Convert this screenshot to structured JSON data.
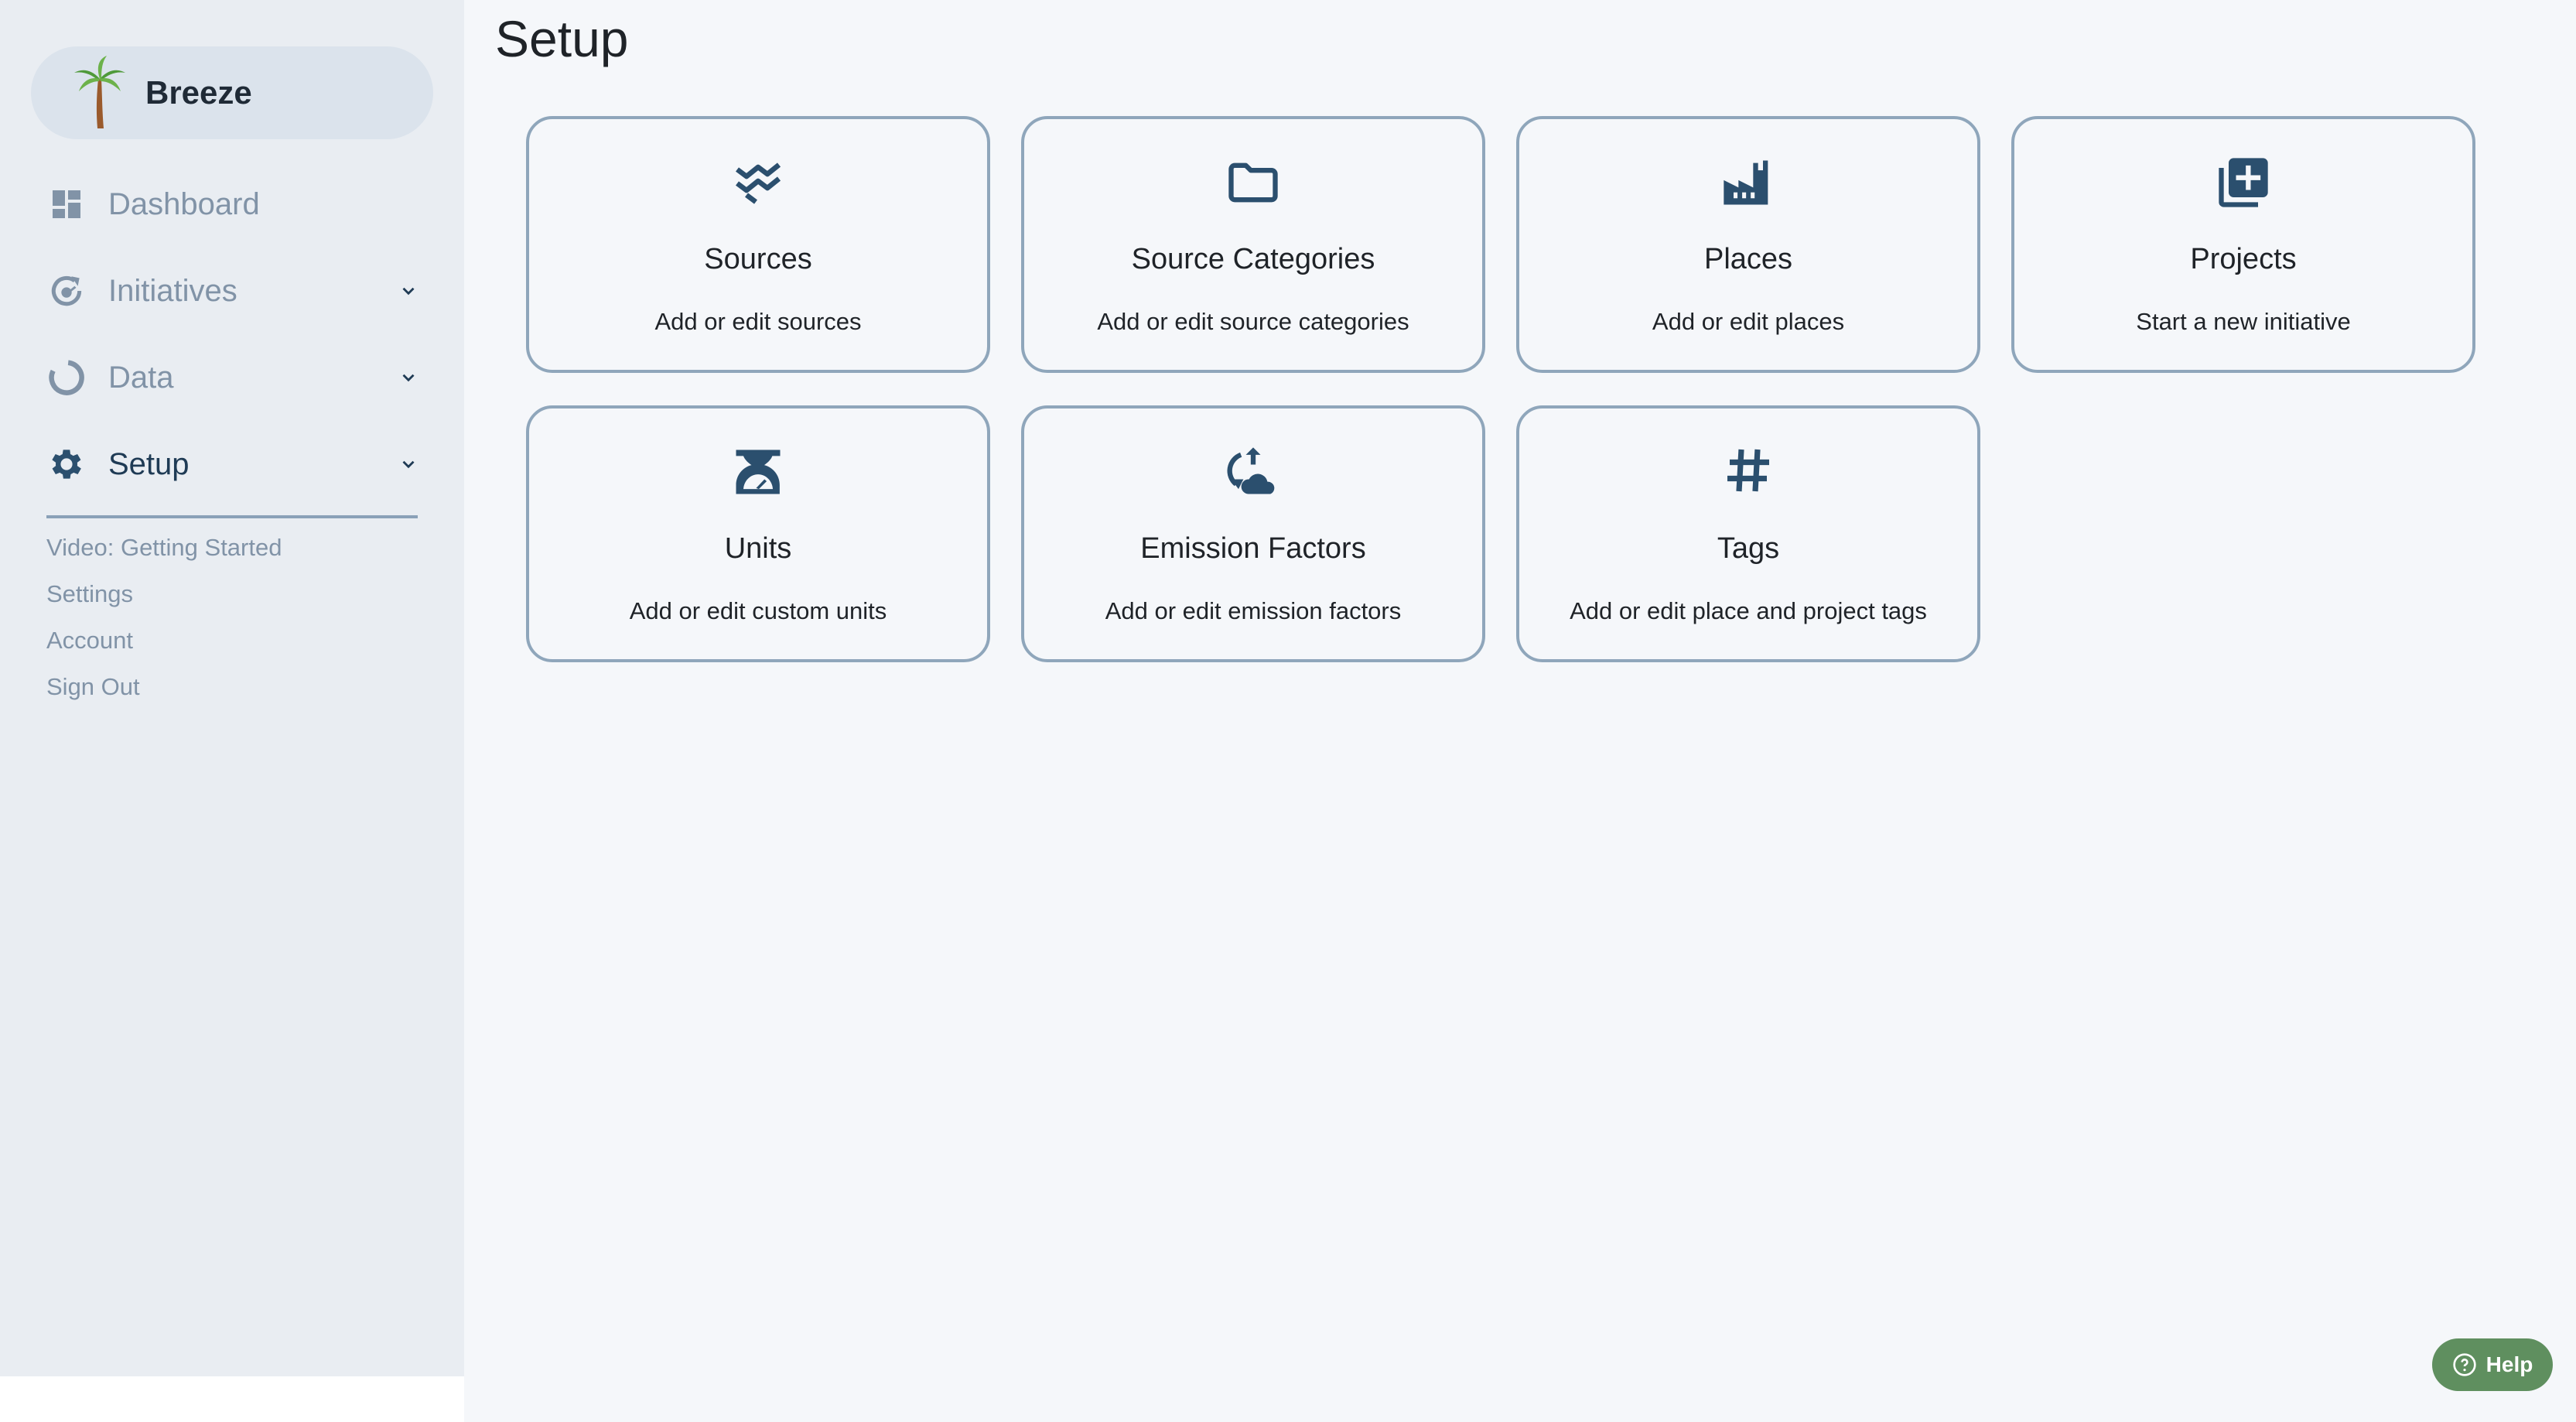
{
  "brand": {
    "name": "Breeze"
  },
  "nav": {
    "items": [
      {
        "label": "Dashboard",
        "icon": "dashboard-icon",
        "has_chevron": false
      },
      {
        "label": "Initiatives",
        "icon": "initiatives-icon",
        "has_chevron": true
      },
      {
        "label": "Data",
        "icon": "data-donut-icon",
        "has_chevron": true
      },
      {
        "label": "Setup",
        "icon": "gear-icon",
        "has_chevron": true,
        "active": true
      }
    ],
    "sub_links": [
      "Video: Getting Started",
      "Settings",
      "Account",
      "Sign Out"
    ]
  },
  "page": {
    "title": "Setup"
  },
  "cards": [
    {
      "title": "Sources",
      "description": "Add or edit sources",
      "icon": "sources-icon"
    },
    {
      "title": "Source Categories",
      "description": "Add or edit source categories",
      "icon": "folder-icon"
    },
    {
      "title": "Places",
      "description": "Add or edit places",
      "icon": "factory-icon"
    },
    {
      "title": "Projects",
      "description": "Start a new initiative",
      "icon": "add-library-icon"
    },
    {
      "title": "Units",
      "description": "Add or edit custom units",
      "icon": "scale-icon"
    },
    {
      "title": "Emission Factors",
      "description": "Add or edit emission factors",
      "icon": "emission-icon"
    },
    {
      "title": "Tags",
      "description": "Add or edit place and project tags",
      "icon": "hashtag-icon"
    }
  ],
  "help": {
    "label": "Help"
  },
  "colors": {
    "accent": "#2b4f6e",
    "sidebar_bg": "#e9edf2",
    "card_border": "#8fa6bb",
    "help_bg": "#5f8f5f"
  }
}
